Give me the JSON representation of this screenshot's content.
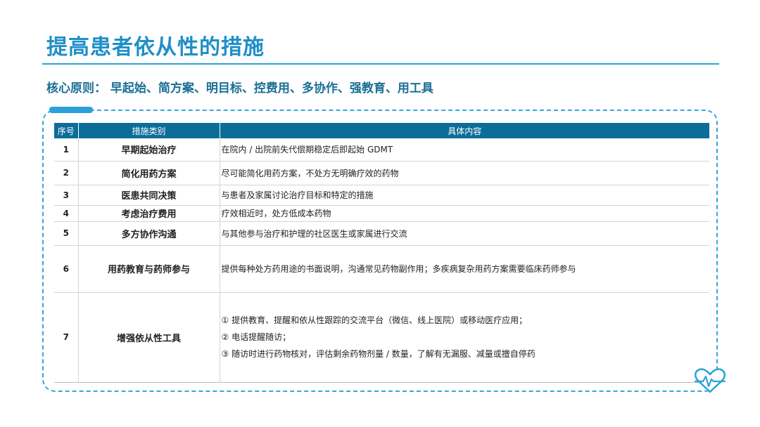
{
  "slide": {
    "title": "提高患者依从性的措施",
    "principle": "核心原则：  早起始、简方案、明目标、控费用、多协作、强教育、用工具"
  },
  "table": {
    "headers": [
      "序号",
      "措施类别",
      "具体内容"
    ],
    "rows": [
      {
        "no": "1",
        "category": "早期起始治疗",
        "details": [
          "在院内 / 出院前失代偿期稳定后即起始 GDMT"
        ]
      },
      {
        "no": "2",
        "category": "简化用药方案",
        "details": [
          "尽可能简化用药方案，不处方无明确疗效的药物"
        ]
      },
      {
        "no": "3",
        "category": "医患共同决策",
        "details": [
          "与患者及家属讨论治疗目标和特定的措施"
        ]
      },
      {
        "no": "4",
        "category": "考虑治疗费用",
        "details": [
          "疗效相近时，处方低成本药物"
        ]
      },
      {
        "no": "5",
        "category": "多方协作沟通",
        "details": [
          "与其他参与治疗和护理的社区医生或家属进行交流"
        ]
      },
      {
        "no": "6",
        "category": "用药教育与药师参与",
        "details": [
          "提供每种处方药用途的书面说明，沟通常见药物副作用；多疾病复杂用药方案需要临床药师参与"
        ]
      },
      {
        "no": "7",
        "category": "增强依从性工具",
        "details": [
          "① 提供教育、提醒和依从性跟踪的交流平台（微信、线上医院）或移动医疗应用；",
          "② 电话提醒随访；",
          "③ 随访时进行药物核对，评估剩余药物剂量 / 数量，了解有无漏服、减量或擅自停药"
        ]
      }
    ]
  },
  "colors": {
    "title": "#1f8fc8",
    "header_bg": "#0c6d98",
    "frame": "#3aa4dc",
    "principle": "#1a6f96"
  },
  "icons": {
    "corner": "heart-pulse-icon"
  }
}
